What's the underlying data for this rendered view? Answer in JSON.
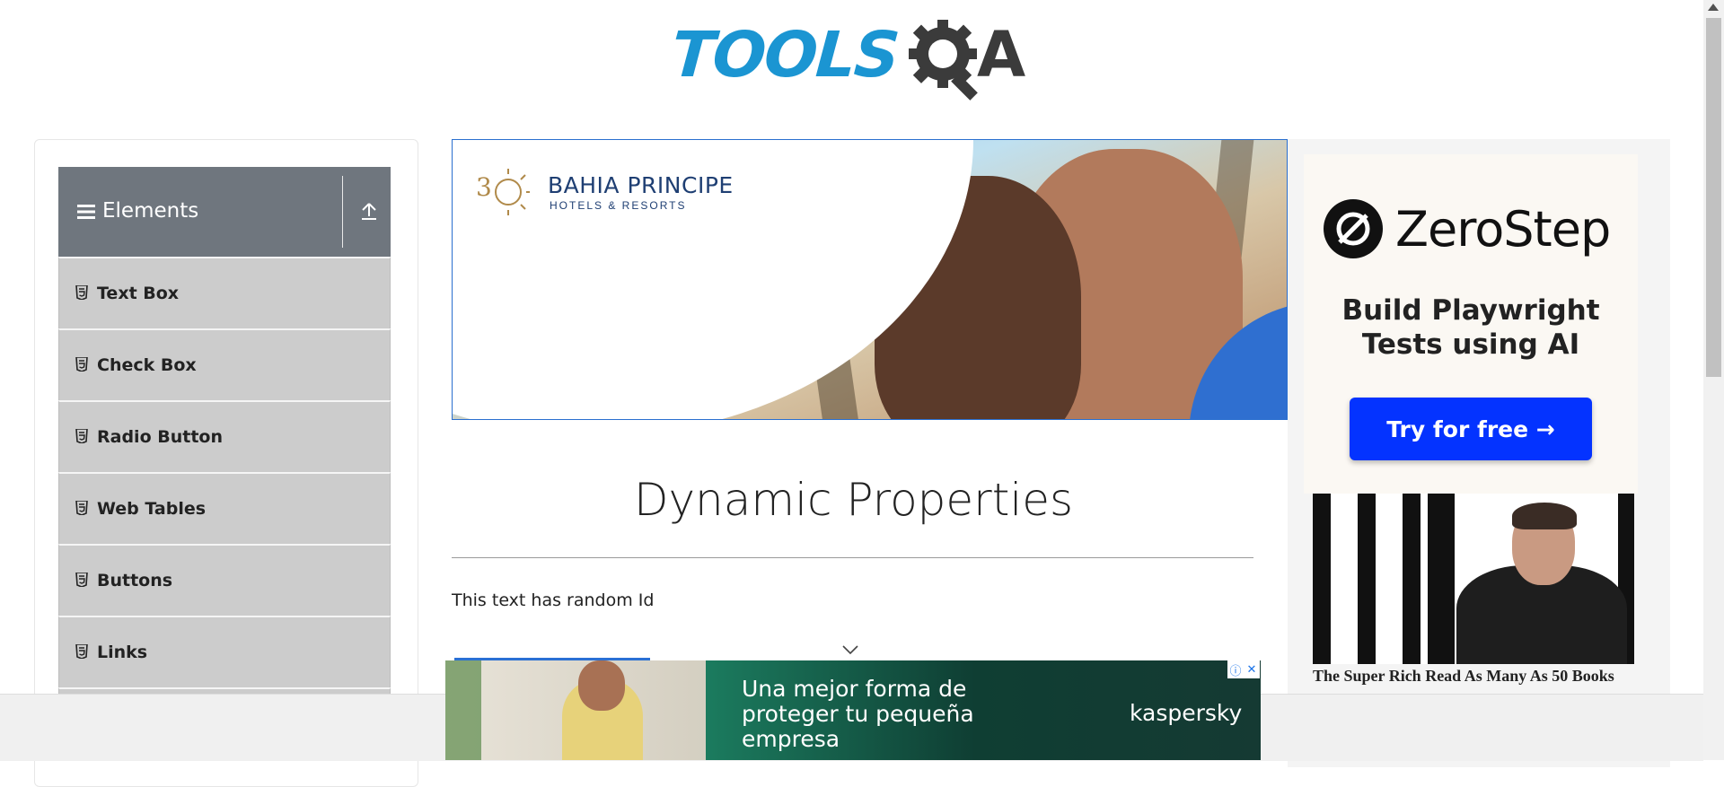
{
  "header": {
    "logo_text_tools": "TOOLS",
    "logo_text_a": "A"
  },
  "sidebar": {
    "group_title": "Elements",
    "items": [
      {
        "label": "Text Box"
      },
      {
        "label": "Check Box"
      },
      {
        "label": "Radio Button"
      },
      {
        "label": "Web Tables"
      },
      {
        "label": "Buttons"
      },
      {
        "label": "Links"
      }
    ]
  },
  "top_ad": {
    "title": "BAHIA PRINCIPE",
    "subtitle": "HOTELS & RESORTS"
  },
  "right_ad": {
    "brand": "ZeroStep",
    "tagline_line1": "Build Playwright",
    "tagline_line2": "Tests using AI",
    "button_label": "Try for free →",
    "article_caption": "The Super Rich Read As Many As 50 Books"
  },
  "main": {
    "page_title": "Dynamic Properties",
    "random_id_text": "This text has random Id"
  },
  "bottom_ad": {
    "headline": "Una mejor forma de proteger tu pequeña empresa",
    "brand": "kaspersky",
    "info_glyph": "ⓘ",
    "close_glyph": "✕"
  },
  "colors": {
    "logo_blue": "#1b95d2",
    "sidebar_header": "#6f767e",
    "sidebar_item": "#cccccc",
    "zerostep_button": "#0433ff"
  }
}
